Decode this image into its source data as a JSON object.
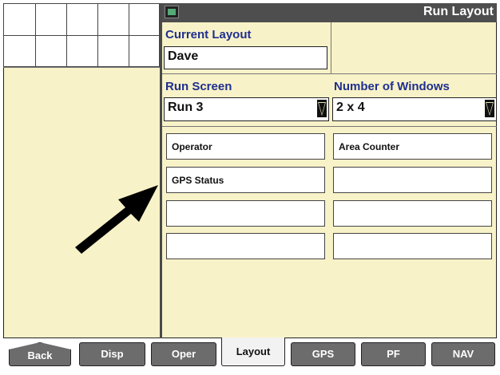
{
  "window": {
    "title": "Run Layout",
    "icon": "display-icon"
  },
  "current_layout": {
    "label": "Current Layout",
    "value": "Dave"
  },
  "run_screen": {
    "label": "Run Screen",
    "value": "Run 3"
  },
  "number_of_windows": {
    "label": "Number of Windows",
    "value": "2 x 4"
  },
  "windows": [
    {
      "label": "Operator"
    },
    {
      "label": "Area Counter"
    },
    {
      "label": "GPS Status"
    },
    {
      "label": ""
    },
    {
      "label": ""
    },
    {
      "label": ""
    },
    {
      "label": ""
    },
    {
      "label": ""
    }
  ],
  "tabs": [
    {
      "label": "Back"
    },
    {
      "label": "Disp"
    },
    {
      "label": "Oper"
    },
    {
      "label": "Layout",
      "active": true
    },
    {
      "label": "GPS"
    },
    {
      "label": "PF"
    },
    {
      "label": "NAV"
    }
  ],
  "colors": {
    "background": "#f8f2c8",
    "label_text": "#1f2f8f",
    "title_bar": "#4e4e4e",
    "tab_inactive": "#6c6c6c",
    "tab_active": "#f2f2f2"
  }
}
